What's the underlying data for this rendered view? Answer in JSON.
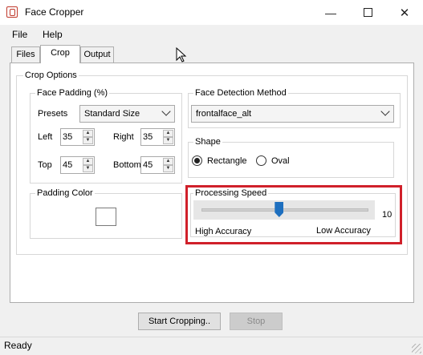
{
  "window": {
    "title": "Face Cropper"
  },
  "menu": {
    "items": [
      "File",
      "Help"
    ]
  },
  "tabs": [
    "Files",
    "Crop",
    "Output"
  ],
  "crop_options": {
    "title": "Crop Options",
    "face_padding": {
      "title": "Face Padding (%)",
      "presets_label": "Presets",
      "preset_value": "Standard Size",
      "left_label": "Left",
      "left_value": "35",
      "right_label": "Right",
      "right_value": "35",
      "top_label": "Top",
      "top_value": "45",
      "bottom_label": "Bottom",
      "bottom_value": "45"
    },
    "detection": {
      "title": "Face Detection Method",
      "value": "frontalface_alt"
    },
    "shape": {
      "title": "Shape",
      "options": [
        "Rectangle",
        "Oval"
      ],
      "selected": "Rectangle"
    },
    "padding_color": {
      "title": "Padding Color",
      "swatch": "#ffffff"
    },
    "processing_speed": {
      "title": "Processing Speed",
      "value": "10",
      "level_fraction": 0.47,
      "left_label": "High Accuracy",
      "right_label": "Low Accuracy",
      "highlight_color": "#d0202a"
    }
  },
  "buttons": {
    "start": "Start Cropping..",
    "stop": "Stop"
  },
  "status": {
    "text": "Ready"
  }
}
